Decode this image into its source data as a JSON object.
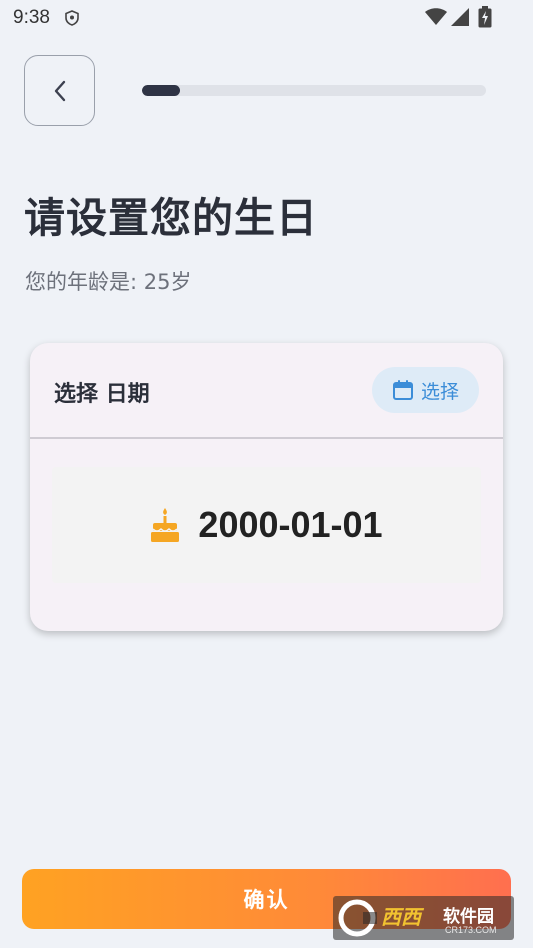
{
  "status_bar": {
    "time": "9:38",
    "icons": [
      "shield-icon",
      "wifi-icon",
      "signal-icon",
      "battery-charging-icon"
    ]
  },
  "header": {
    "back_icon": "chevron-left-icon",
    "progress_fraction": 0.11
  },
  "page": {
    "title": "请设置您的生日",
    "age_text": "您的年龄是: 25岁"
  },
  "card": {
    "title": "选择 日期",
    "select_button": {
      "icon": "calendar-icon",
      "label": "选择"
    },
    "date_icon": "cake-icon",
    "date_value": "2000-01-01"
  },
  "footer": {
    "confirm_label": "确认"
  },
  "watermark": {
    "brand": "西西",
    "name": "软件园",
    "url": "CR173.COM"
  },
  "colors": {
    "background": "#eff2f7",
    "accent_blue": "#3c8dd8",
    "cake_orange": "#f5a623",
    "button_gradient_start": "#ffa222",
    "button_gradient_end": "#ff6f4f"
  }
}
